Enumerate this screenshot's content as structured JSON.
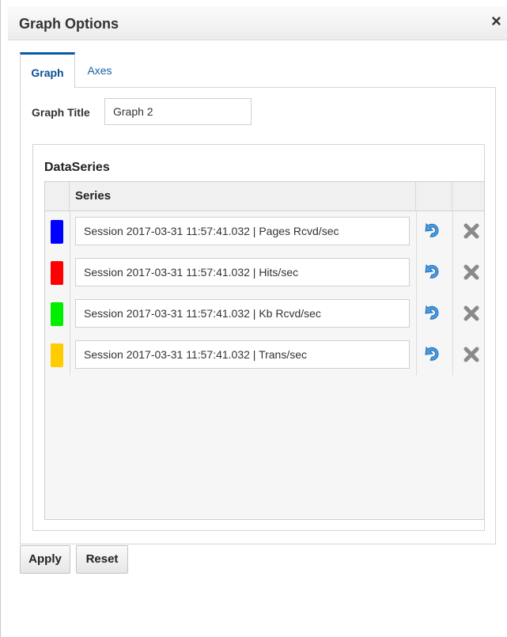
{
  "dialog": {
    "title": "Graph Options",
    "close_glyph": "×"
  },
  "tabs": [
    {
      "label": "Graph",
      "active": true
    },
    {
      "label": "Axes",
      "active": false
    }
  ],
  "graph": {
    "title_label": "Graph Title",
    "title_value": "Graph 2"
  },
  "dataseries": {
    "heading": "DataSeries",
    "column_header": "Series",
    "rows": [
      {
        "color": "#0000ff",
        "name": "Session 2017-03-31 11:57:41.032 | Pages Rcvd/sec"
      },
      {
        "color": "#ff0000",
        "name": "Session 2017-03-31 11:57:41.032 | Hits/sec"
      },
      {
        "color": "#00ee00",
        "name": "Session 2017-03-31 11:57:41.032 | Kb Rcvd/sec"
      },
      {
        "color": "#ffcc00",
        "name": "Session 2017-03-31 11:57:41.032 | Trans/sec"
      }
    ],
    "row_icons": {
      "undo": "undo-arrow-icon",
      "delete": "delete-x-icon"
    }
  },
  "buttons": {
    "apply": "Apply",
    "reset": "Reset"
  }
}
